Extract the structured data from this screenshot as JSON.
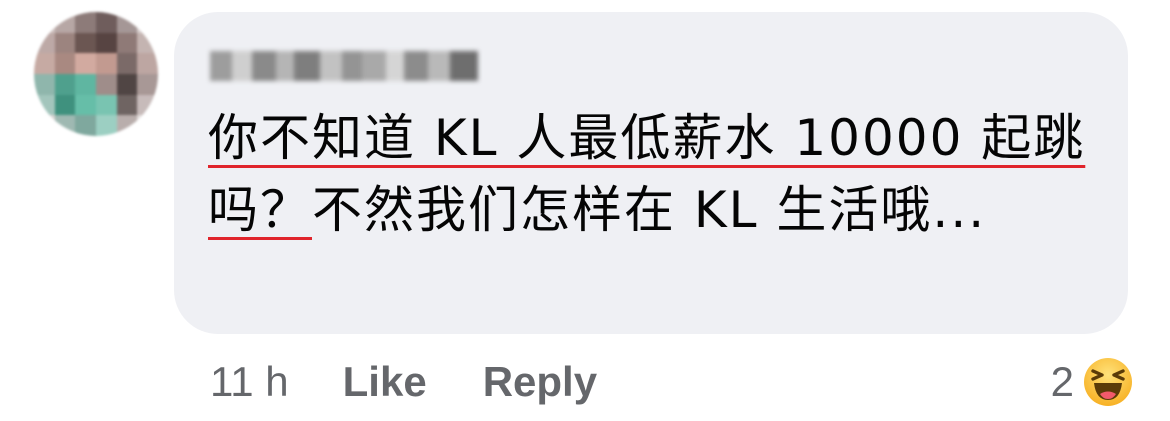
{
  "comment": {
    "text_parts": [
      {
        "text": "你不知道 KL 人最低薪水 10000 起跳吗？",
        "underlined": true
      },
      {
        "text": "不然我们怎样在 KL 生活哦...",
        "underlined": false
      }
    ],
    "timestamp": "11 h",
    "like_label": "Like",
    "reply_label": "Reply",
    "reaction_count": "2",
    "reaction_icon": "haha-emoji-icon"
  },
  "colors": {
    "bubble_bg": "#eff0f4",
    "underline": "#e0242b",
    "meta_text": "#65676b",
    "body_text": "#050505"
  }
}
